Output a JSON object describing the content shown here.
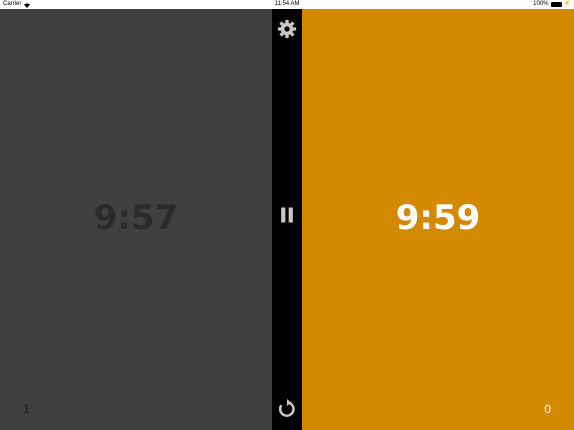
{
  "status_bar": {
    "carrier": "Carrier",
    "time": "11:54 AM",
    "battery": "100%",
    "battery_level": 1.0,
    "icons": [
      "wifi-icon",
      "battery-icon",
      "charging-icon"
    ]
  },
  "player_left": {
    "time": "9:57",
    "moves": "1",
    "color": "#404040",
    "text_color": "#2b2b2b"
  },
  "player_right": {
    "time": "9:59",
    "moves": "0",
    "color": "#d48a00",
    "text_color": "#ffffff"
  },
  "controls": {
    "settings_icon": "gear-icon",
    "pause_icon": "pause-icon",
    "reset_icon": "reset-icon",
    "icon_color": "#c8c8c8"
  }
}
